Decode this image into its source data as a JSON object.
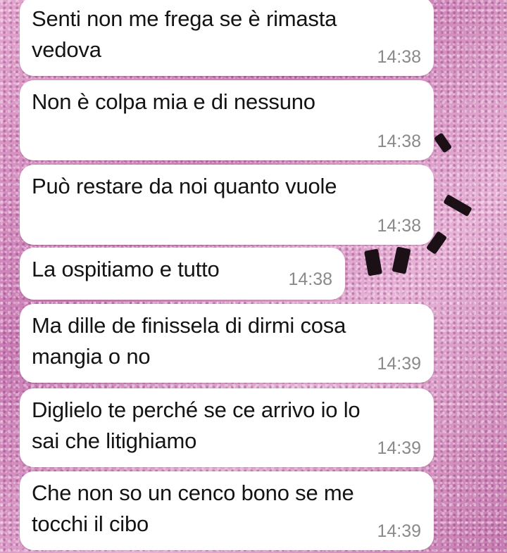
{
  "messages": [
    {
      "text": "Senti non me frega se è rimasta\nvedova",
      "time": "14:38"
    },
    {
      "text": "Non è colpa mia e di nessuno",
      "time": "14:38"
    },
    {
      "text": "Può restare da noi quanto vuole",
      "time": "14:38"
    },
    {
      "text": "La ospitiamo e tutto",
      "time": "14:38"
    },
    {
      "text": "Ma dille de finissela di dirmi cosa\nmangia o no",
      "time": "14:39"
    },
    {
      "text": "Diglielo te perché se ce arrivo io lo\nsai che litighiamo",
      "time": "14:39"
    },
    {
      "text": "Che non so un cenco bono se me\ntocchi il cibo",
      "time": "14:39"
    }
  ]
}
